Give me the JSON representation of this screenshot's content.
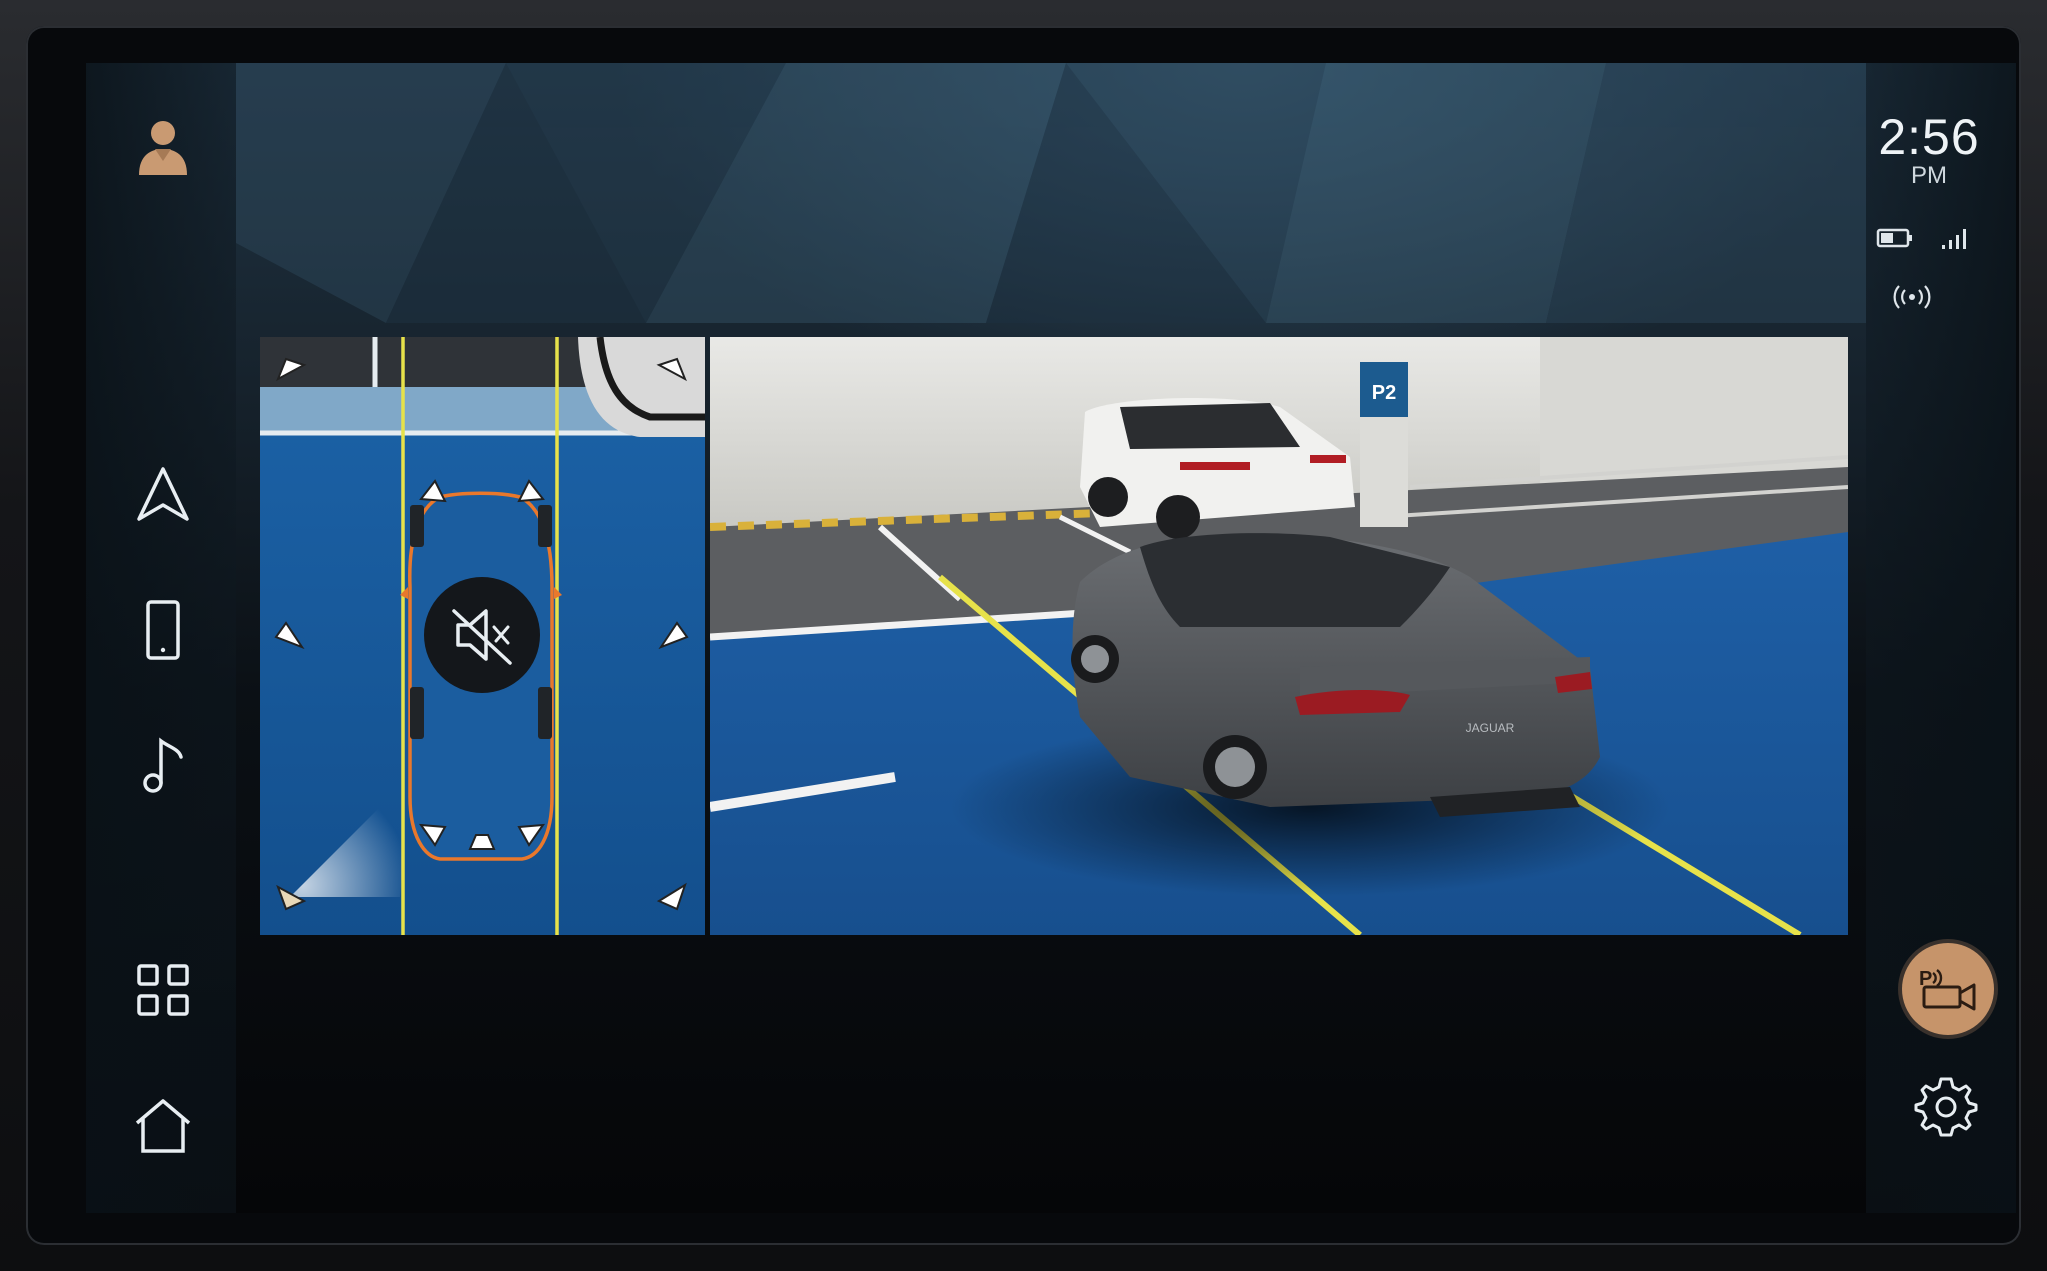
{
  "status_bar": {
    "time": "2:56",
    "period": "PM"
  },
  "camera": {
    "parking_bay_label": "P2",
    "badge_text": "JAGUAR"
  },
  "icons": {
    "profile": "profile-icon",
    "navigation": "navigation-icon",
    "phone": "phone-icon",
    "media": "music-note-icon",
    "apps": "apps-grid-icon",
    "home": "home-icon",
    "battery": "battery-icon",
    "signal": "signal-icon",
    "connectivity": "wireless-broadcast-icon",
    "parking_camera": "parking-camera-icon",
    "settings": "gear-icon",
    "mute": "mute-icon"
  },
  "colors": {
    "accent": "#c6946a",
    "guide_line": "#e7e24a",
    "vehicle_outline": "#e9782c",
    "top_view_floor": "#17599a"
  }
}
